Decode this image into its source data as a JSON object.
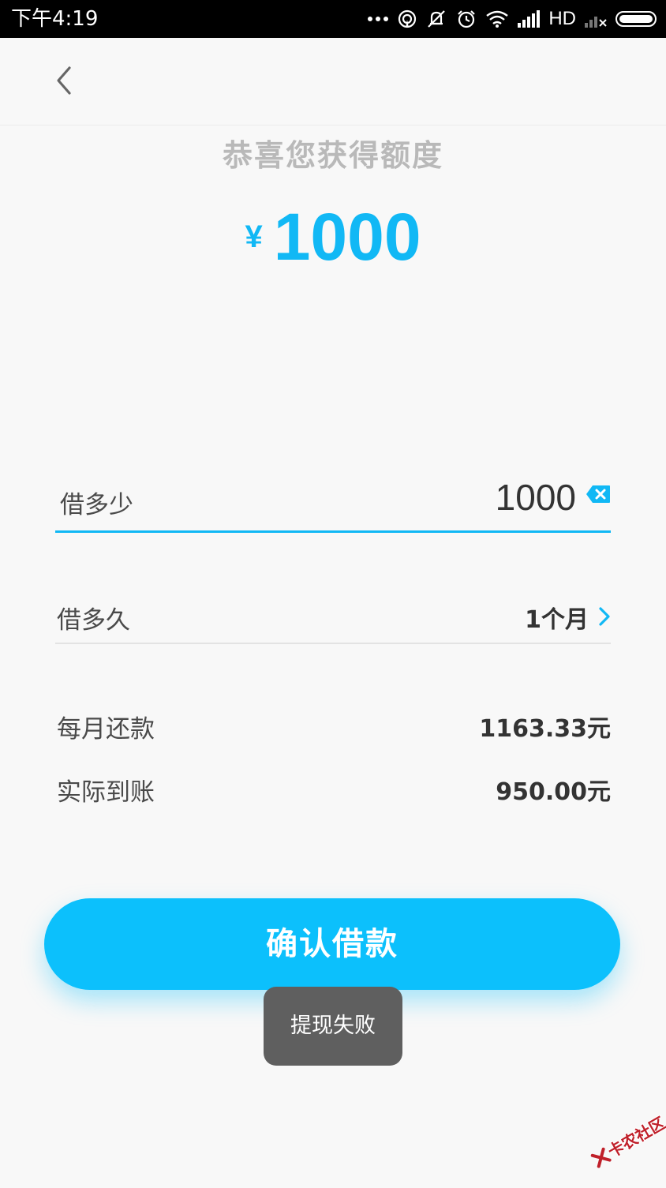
{
  "status_bar": {
    "time": "下午4:19",
    "network_type": "HD",
    "icons": [
      "more-dots-icon",
      "hotspot-icon",
      "mute-icon",
      "alarm-icon",
      "wifi-icon",
      "signal-icon",
      "signal-weak-icon",
      "battery-icon"
    ]
  },
  "header": {
    "back_icon": "chevron-left-icon"
  },
  "credit": {
    "title": "恭喜您获得额度",
    "currency_symbol": "¥",
    "amount": "1000"
  },
  "form": {
    "amount_label": "借多少",
    "amount_value": "1000",
    "clear_icon": "backspace-icon",
    "term_label": "借多久",
    "term_value": "1个月",
    "monthly_label": "每月还款",
    "monthly_value": "1163.33元",
    "received_label": "实际到账",
    "received_value": "950.00元"
  },
  "confirm_button": {
    "label": "确认借款"
  },
  "toast": {
    "message": "提现失败"
  },
  "watermark": {
    "text": "卡农社区"
  },
  "colors": {
    "accent": "#0cc0fc",
    "amount_text": "#11b8f5",
    "title_gray": "#b9b9b9",
    "toast_bg": "#5f5f5f",
    "status_bar": "#000000",
    "background": "#f8f8f8"
  }
}
